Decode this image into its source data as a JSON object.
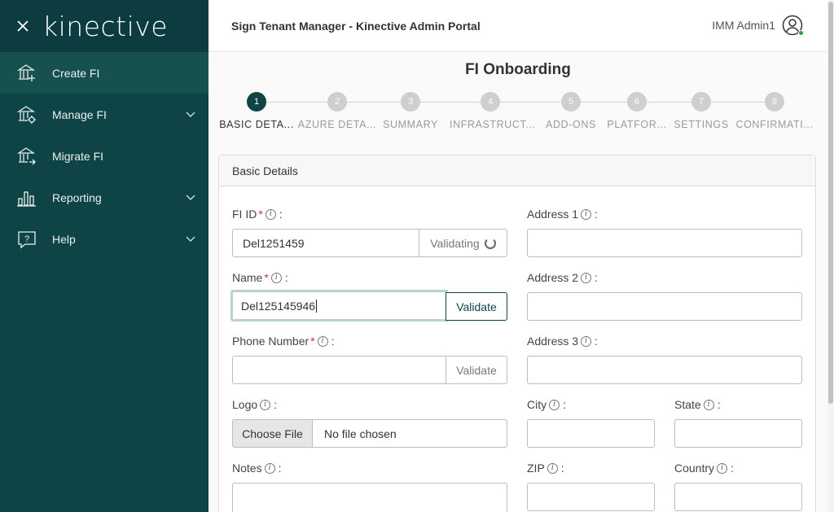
{
  "sidebar": {
    "logo": "kinective",
    "items": [
      {
        "label": "Create FI",
        "icon": "bank-add-icon",
        "active": true,
        "expandable": false
      },
      {
        "label": "Manage FI",
        "icon": "bank-settings-icon",
        "active": false,
        "expandable": true
      },
      {
        "label": "Migrate FI",
        "icon": "bank-migrate-icon",
        "active": false,
        "expandable": false
      },
      {
        "label": "Reporting",
        "icon": "bar-chart-icon",
        "active": false,
        "expandable": true
      },
      {
        "label": "Help",
        "icon": "help-icon",
        "active": false,
        "expandable": true
      }
    ]
  },
  "header": {
    "title": "Sign Tenant Manager - Kinective Admin Portal",
    "user": "IMM Admin1"
  },
  "page": {
    "title": "FI Onboarding"
  },
  "stepper": {
    "current": 1,
    "steps": [
      {
        "num": "1",
        "label": "BASIC DETA..."
      },
      {
        "num": "2",
        "label": "AZURE DETA..."
      },
      {
        "num": "3",
        "label": "SUMMARY"
      },
      {
        "num": "4",
        "label": "INFRASTRUCT..."
      },
      {
        "num": "5",
        "label": "ADD-ONS"
      },
      {
        "num": "6",
        "label": "PLATFOR..."
      },
      {
        "num": "7",
        "label": "SETTINGS"
      },
      {
        "num": "8",
        "label": "CONFIRMATI..."
      }
    ]
  },
  "form": {
    "section_title": "Basic Details",
    "fi_id": {
      "label": "FI ID",
      "value": "Del1251459",
      "button": "Validating"
    },
    "name": {
      "label": "Name",
      "value": "Del125145946",
      "button": "Validate"
    },
    "phone": {
      "label": "Phone Number",
      "value": "",
      "button": "Validate"
    },
    "logo": {
      "label": "Logo",
      "button": "Choose File",
      "status": "No file chosen"
    },
    "notes": {
      "label": "Notes",
      "value": ""
    },
    "address1": {
      "label": "Address 1",
      "value": ""
    },
    "address2": {
      "label": "Address 2",
      "value": ""
    },
    "address3": {
      "label": "Address 3",
      "value": ""
    },
    "city": {
      "label": "City",
      "value": ""
    },
    "state": {
      "label": "State",
      "value": ""
    },
    "zip": {
      "label": "ZIP",
      "value": ""
    },
    "country": {
      "label": "Country",
      "value": ""
    }
  },
  "colors": {
    "sidebar": "#0f4447",
    "accent": "#0f4447",
    "required": "#d32f2f",
    "online": "#2e9e44"
  }
}
